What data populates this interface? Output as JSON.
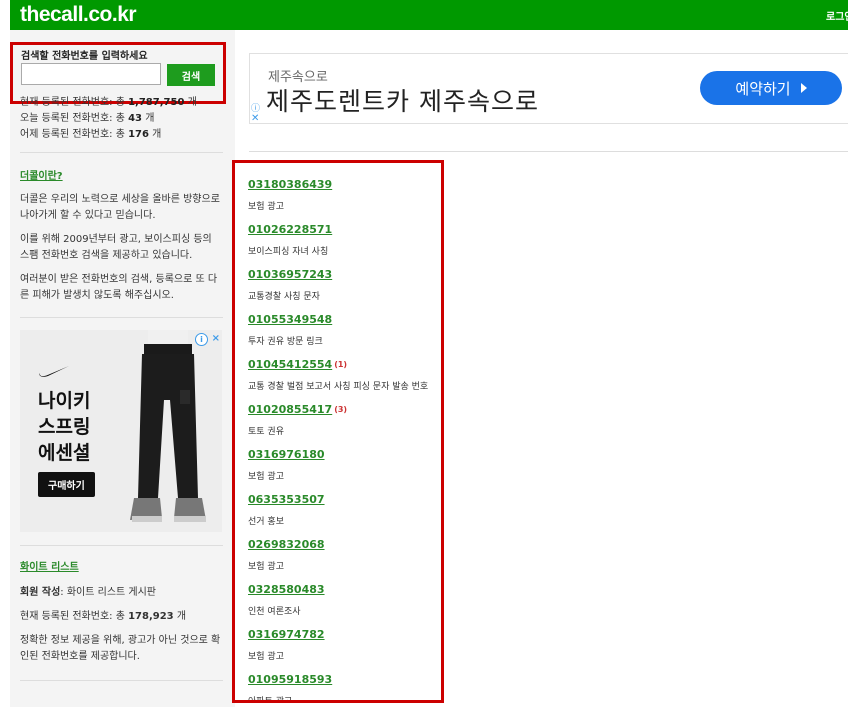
{
  "header": {
    "logo": "thecall.co.kr",
    "login_label": "로그인"
  },
  "search": {
    "title": "검색할 전화번호를 입력하세요",
    "input_value": "",
    "button_label": "검색"
  },
  "stats": {
    "total_prefix": "현재 등록된 전화번호: 총 ",
    "total_value": "1,787,750",
    "total_suffix": " 개",
    "today_prefix": "오늘 등록된 전화번호: 총 ",
    "today_value": "43",
    "today_suffix": " 개",
    "yesterday_prefix": "어제 등록된 전화번호: 총 ",
    "yesterday_value": "176",
    "yesterday_suffix": " 개"
  },
  "about": {
    "link": "더콜이란?",
    "p1": "더콜은 우리의 노력으로 세상을 올바른 방향으로 나아가게 할 수 있다고 믿습니다.",
    "p2": "이를 위해 2009년부터 광고, 보이스피싱 등의 스팸 전화번호 검색을 제공하고 있습니다.",
    "p3": "여러분이 받은 전화번호의 검색, 등록으로 또 다른 피해가 발생치 않도록 해주십시오."
  },
  "sidebar_ad": {
    "line1": "나이키",
    "line2": "스프링",
    "line3": "에센셜",
    "cta": "구매하기",
    "colors": {
      "bg": "#ededed",
      "cta_bg": "#111111"
    }
  },
  "white_list": {
    "link": "화이트 리스트",
    "member_label": "회원 작성",
    "member_value": ": 화이트 리스트 게시판",
    "count_prefix": "현재 등록된 전화번호: 총 ",
    "count_value": "178,923",
    "count_suffix": " 개",
    "note": "정확한 정보 제공을 위해, 광고가 아닌 것으로 확인된 전화번호를 제공합니다."
  },
  "banner": {
    "small_text": "제주속으로",
    "big_text": "제주도렌트카 제주속으로",
    "cta": "예약하기",
    "colors": {
      "cta_bg": "#1a73e8"
    }
  },
  "results": [
    {
      "number": "03180386439",
      "count": "",
      "desc": "보험 광고"
    },
    {
      "number": "01026228571",
      "count": "",
      "desc": "보이스피싱 자녀 사칭"
    },
    {
      "number": "01036957243",
      "count": "",
      "desc": "교통경찰 사칭 문자"
    },
    {
      "number": "01055349548",
      "count": "",
      "desc": "투자 권유 방문 링크"
    },
    {
      "number": "01045412554",
      "count": "(1)",
      "desc": "교통 경찰 벌점 보고서 사칭 피싱 문자 발송 번호"
    },
    {
      "number": "01020855417",
      "count": "(3)",
      "desc": "토토 권유"
    },
    {
      "number": "0316976180",
      "count": "",
      "desc": "보험 광고"
    },
    {
      "number": "0635353507",
      "count": "",
      "desc": "선거 홍보"
    },
    {
      "number": "0269832068",
      "count": "",
      "desc": "보험 광고"
    },
    {
      "number": "0328580483",
      "count": "",
      "desc": "인천 여론조사"
    },
    {
      "number": "0316974782",
      "count": "",
      "desc": "보험 광고"
    },
    {
      "number": "01095918593",
      "count": "",
      "desc": "아파트 광고"
    }
  ],
  "colors": {
    "header": "#009900",
    "link_green": "#2a8a2a",
    "highlight_red": "#cc0000",
    "count_red": "#cc3333"
  }
}
